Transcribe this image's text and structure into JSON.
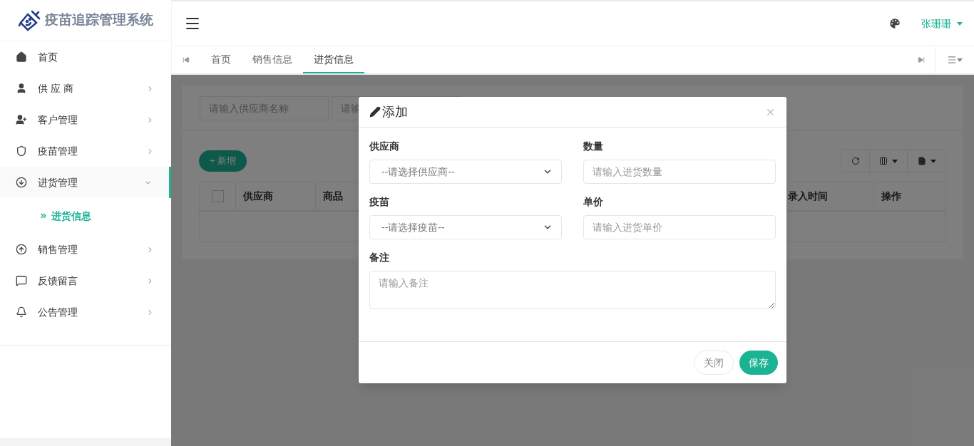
{
  "brand": {
    "title": "疫苗追踪管理系统"
  },
  "sidebar": {
    "items": [
      {
        "label": "首页",
        "selected": false
      },
      {
        "label": "供 应 商",
        "selected": false,
        "expanded": false
      },
      {
        "label": "客户管理",
        "selected": false,
        "expanded": false
      },
      {
        "label": "疫苗管理",
        "selected": false,
        "expanded": false
      },
      {
        "label": "进货管理",
        "selected": true,
        "expanded": true,
        "children": [
          {
            "label": "进货信息",
            "selected": true
          }
        ]
      },
      {
        "label": "销售管理",
        "selected": false,
        "expanded": false
      },
      {
        "label": "反馈留言",
        "selected": false,
        "expanded": false
      },
      {
        "label": "公告管理",
        "selected": false,
        "expanded": false
      }
    ]
  },
  "header": {
    "user": "张珊珊"
  },
  "tabs": [
    {
      "label": "首页",
      "selected": false
    },
    {
      "label": "销售信息",
      "selected": false
    },
    {
      "label": "进货信息",
      "selected": true
    }
  ],
  "page": {
    "search_fields": [
      {
        "placeholder": "请输入供应商名称"
      },
      {
        "placeholder": "请输"
      }
    ],
    "add_button": "+ 新增",
    "table": {
      "select_all_checked": false,
      "columns": [
        "供应商",
        "商品",
        "录入时间",
        "操作"
      ]
    }
  },
  "modal": {
    "title": "添加",
    "fields": [
      {
        "kind": "select",
        "label": "供应商",
        "value": "--请选择供应商--"
      },
      {
        "kind": "input",
        "label": "数量",
        "placeholder": "请输入进货数量"
      },
      {
        "kind": "select",
        "label": "疫苗",
        "value": "--请选择疫苗--"
      },
      {
        "kind": "input",
        "label": "单价",
        "placeholder": "请输入进货单价"
      },
      {
        "kind": "textarea",
        "label": "备注",
        "placeholder": "请输入备注"
      }
    ],
    "buttons": [
      {
        "label": "关闭",
        "kind": "secondary"
      },
      {
        "label": "保存",
        "kind": "primary"
      }
    ]
  }
}
